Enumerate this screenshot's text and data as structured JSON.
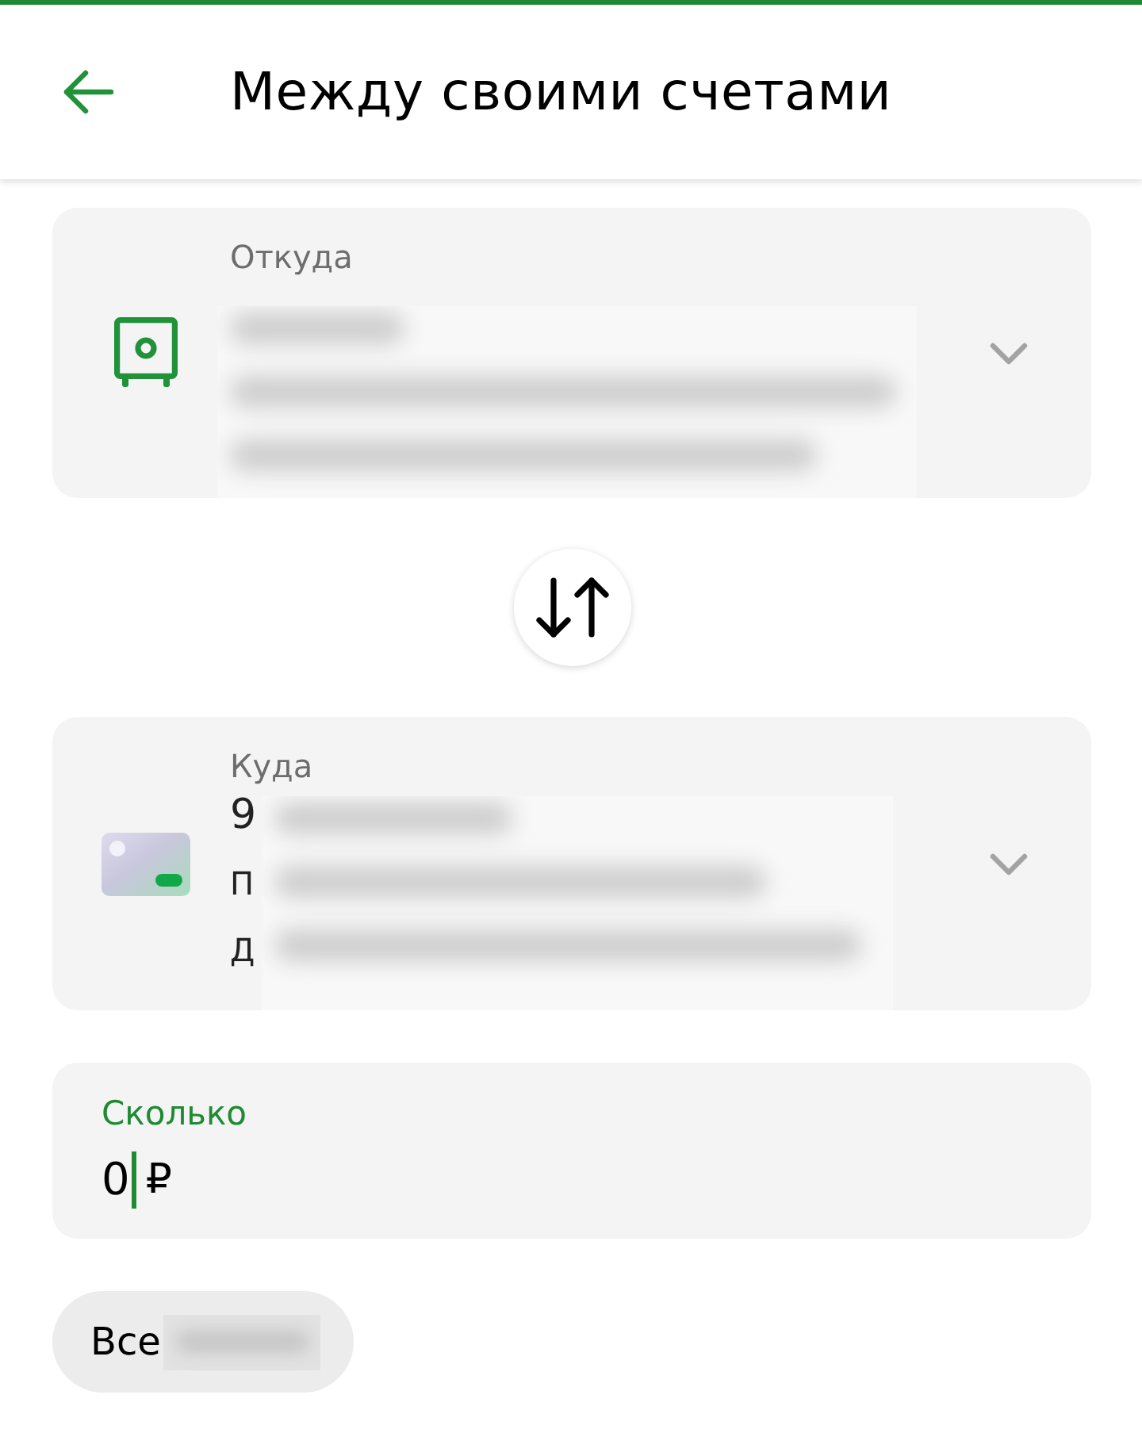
{
  "header": {
    "title": "Между своими счетами"
  },
  "accounts": [
    {
      "label": "Откуда",
      "kind": "safe",
      "redacted": true
    },
    {
      "label": "Куда",
      "kind": "card",
      "redacted": true,
      "lines": [
        "9",
        "П",
        "Д"
      ]
    }
  ],
  "amount": {
    "label": "Сколько",
    "value": "0",
    "currency": "₽",
    "focused": true
  },
  "all_chip": {
    "label": "Все",
    "redacted": true
  }
}
